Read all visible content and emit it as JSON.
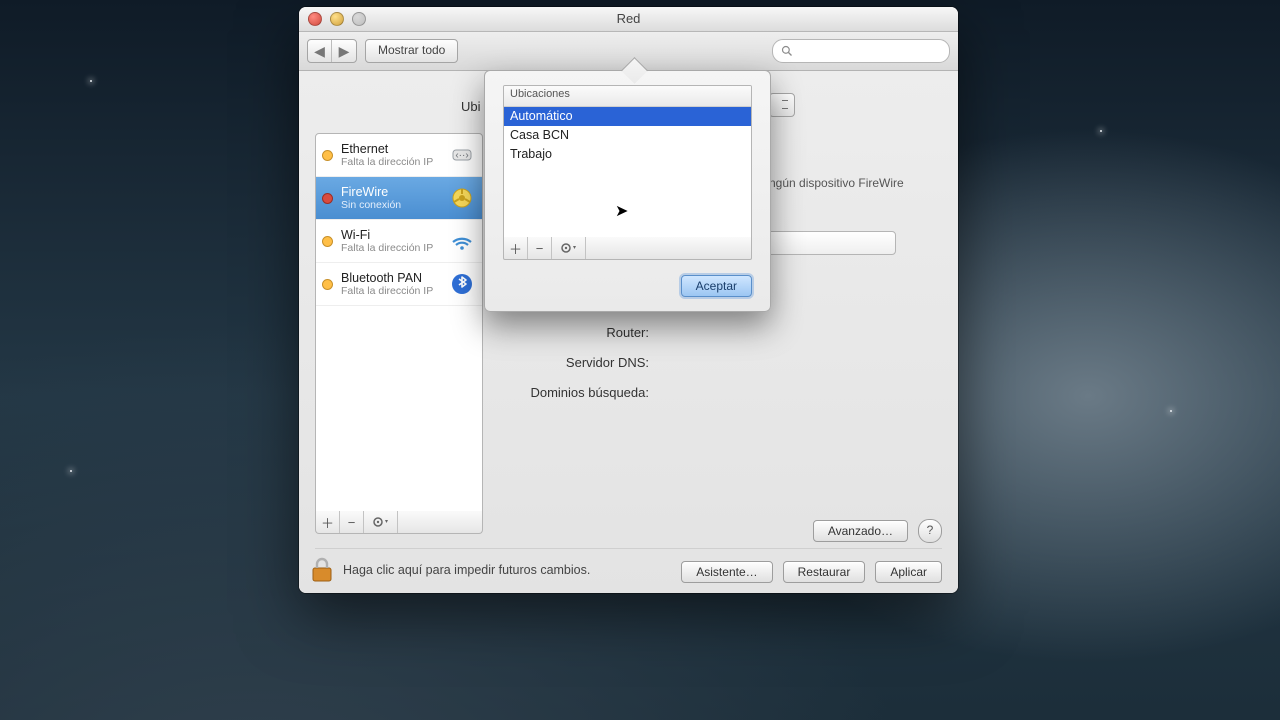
{
  "window": {
    "title": "Red",
    "show_all": "Mostrar todo",
    "location_label": "Ubi",
    "firewire_note": "ngún dispositivo FireWire"
  },
  "services": [
    {
      "name": "Ethernet",
      "sub": "Falta la dirección IP",
      "status": "yellow",
      "icon": "ethernet"
    },
    {
      "name": "FireWire",
      "sub": "Sin conexión",
      "status": "red",
      "icon": "firewire",
      "selected": true
    },
    {
      "name": "Wi-Fi",
      "sub": "Falta la dirección IP",
      "status": "yellow",
      "icon": "wifi"
    },
    {
      "name": "Bluetooth PAN",
      "sub": "Falta la dirección IP",
      "status": "yellow",
      "icon": "bluetooth"
    }
  ],
  "detail_labels": {
    "router": "Router:",
    "dns": "Servidor DNS:",
    "search_domains": "Dominios búsqueda:"
  },
  "popover": {
    "header": "Ubicaciones",
    "items": [
      "Automático",
      "Casa BCN",
      "Trabajo"
    ],
    "selected_index": 0,
    "accept": "Aceptar"
  },
  "buttons": {
    "advanced": "Avanzado…",
    "assistant": "Asistente…",
    "restore": "Restaurar",
    "apply": "Aplicar"
  },
  "lock_text": "Haga clic aquí para impedir futuros cambios.",
  "icons": {
    "plus": "＋",
    "minus": "−",
    "gear": "✻▾",
    "help": "?",
    "back": "◀",
    "fwd": "▶"
  }
}
